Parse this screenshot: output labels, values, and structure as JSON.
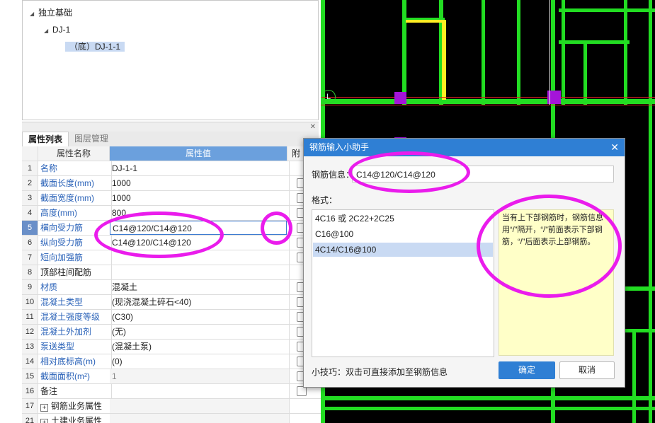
{
  "tree": {
    "root": "独立基础",
    "child": "DJ-1",
    "leaf": "（底）DJ-1-1"
  },
  "tabs": [
    "属性列表",
    "图层管理"
  ],
  "grid": {
    "header_name": "属性名称",
    "header_value": "属性值",
    "header_attach": "附",
    "rows": [
      {
        "no": "1",
        "name": "名称",
        "value": "DJ-1-1"
      },
      {
        "no": "2",
        "name": "截面长度(mm)",
        "value": "1000"
      },
      {
        "no": "3",
        "name": "截面宽度(mm)",
        "value": "1000"
      },
      {
        "no": "4",
        "name": "高度(mm)",
        "value": "800"
      },
      {
        "no": "5",
        "name": "横向受力筋",
        "value": "C14@120/C14@120"
      },
      {
        "no": "6",
        "name": "纵向受力筋",
        "value": "C14@120/C14@120"
      },
      {
        "no": "7",
        "name": "短向加强筋",
        "value": ""
      },
      {
        "no": "8",
        "name": "顶部柱间配筋",
        "value": ""
      },
      {
        "no": "9",
        "name": "材质",
        "value": "混凝土"
      },
      {
        "no": "10",
        "name": "混凝土类型",
        "value": "(现浇混凝土碎石<40)"
      },
      {
        "no": "11",
        "name": "混凝土强度等级",
        "value": "(C30)"
      },
      {
        "no": "12",
        "name": "混凝土外加剂",
        "value": "(无)"
      },
      {
        "no": "13",
        "name": "泵送类型",
        "value": "(混凝土泵)"
      },
      {
        "no": "14",
        "name": "相对底标高(m)",
        "value": "(0)"
      },
      {
        "no": "15",
        "name": "截面面积(m²)",
        "value": "1"
      },
      {
        "no": "16",
        "name": "备注",
        "value": ""
      },
      {
        "no": "17",
        "name": "钢筋业务属性",
        "value": ""
      },
      {
        "no": "21",
        "name": "土建业务属性",
        "value": ""
      }
    ]
  },
  "cad": {
    "axis_label": "L"
  },
  "dialog": {
    "title": "钢筋输入小助手",
    "info_label": "钢筋信息",
    "info_value": "C14@120/C14@120",
    "format_label": "格式：",
    "formats": [
      "4C16 或 2C22+2C25",
      "C16@100",
      "4C14/C16@100"
    ],
    "tip": "当有上下部钢筋时，钢筋信息用“/”隔开，“/”前面表示下部钢筋，“/”后面表示上部钢筋。",
    "hint": "小技巧：双击可直接添加至钢筋信息",
    "ok": "确定",
    "cancel": "取消"
  },
  "colors": {
    "accent": "#2f7fd4",
    "annotation": "#ea1cec",
    "cad_line": "#22dd22",
    "cad_highlight": "#ffee22"
  }
}
